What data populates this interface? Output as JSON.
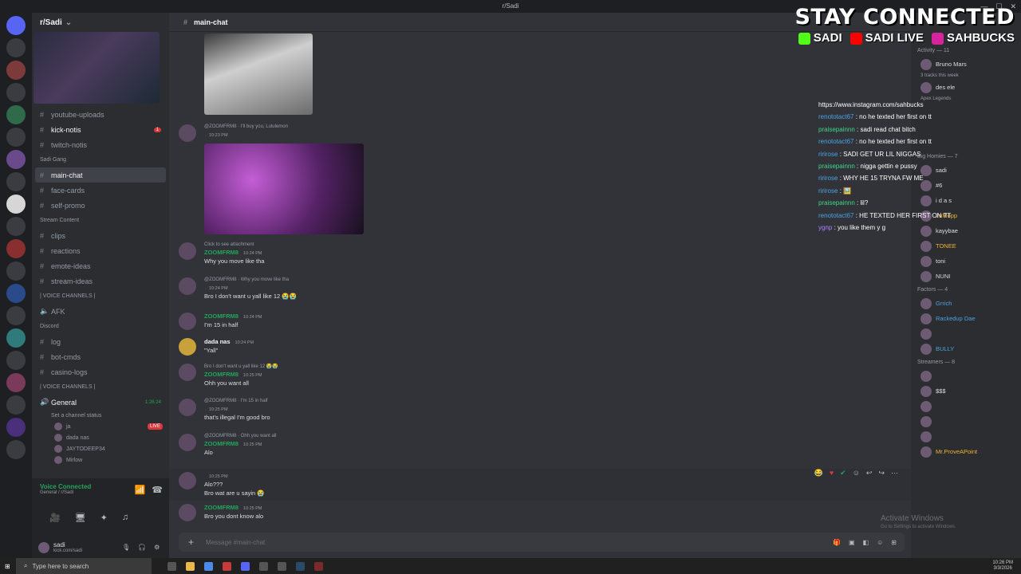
{
  "window": {
    "title": "r/Sadi"
  },
  "server": {
    "name": "r/Sadi",
    "channels_top": [
      {
        "label": "youtube-uploads"
      },
      {
        "label": "kick-notis",
        "badge": "1"
      },
      {
        "label": "twitch-notis"
      }
    ],
    "categories": {
      "sadi_gang": "Sadi Gang",
      "stream_content": "Stream Content",
      "voice": "| VOICE CHANNELS |",
      "discord": "Discord",
      "voice2": "| VOICE CHANNELS |"
    },
    "sadi_gang_channels": [
      {
        "label": "main-chat",
        "active": true
      },
      {
        "label": "face-cards"
      },
      {
        "label": "self-promo"
      }
    ],
    "stream_channels": [
      {
        "label": "clips"
      },
      {
        "label": "reactions"
      },
      {
        "label": "emote-ideas"
      },
      {
        "label": "stream-ideas"
      }
    ],
    "afk": "AFK",
    "discord_channels": [
      {
        "label": "log"
      },
      {
        "label": "bot-cmds"
      },
      {
        "label": "casino-logs"
      }
    ],
    "voice_general": {
      "label": "General",
      "timer": "1:26:24",
      "status": "Set a channel status"
    },
    "voice_users": [
      {
        "name": "ja",
        "live": "LIVE"
      },
      {
        "name": "dada nas"
      },
      {
        "name": "JAYTODEEP34"
      },
      {
        "name": "Mirlow"
      }
    ]
  },
  "voice_bar": {
    "title": "Voice Connected",
    "sub": "General / r/Sadi"
  },
  "user": {
    "name": "sadi",
    "status": "kick.com/sadi"
  },
  "chat": {
    "channel": "main-chat",
    "composer_placeholder": "Message #main-chat",
    "messages": [
      {
        "reply": "@ZOOMFRM8 · I'll buy you, Lululemon",
        "author": "",
        "time": "10:23 PM",
        "text": ""
      },
      {
        "reply": "Click to see attachment",
        "author": "ZOOMFRM8",
        "time": "10:24 PM",
        "text": "Why you move like tha"
      },
      {
        "reply": "@ZOOMFRM8 · Why you move like tha",
        "author": "",
        "time": "10:24 PM",
        "text": "Bro I don't want u yall like 12 😭😭"
      },
      {
        "reply": "",
        "author": "ZOOMFRM8",
        "time": "10:24 PM",
        "text": "I'm 15 in half"
      },
      {
        "reply": "",
        "author": "dada nas",
        "time": "10:24 PM",
        "text": "\"Yall\""
      },
      {
        "reply": "Bro I don't want u yall like 12 😭😭",
        "author": "ZOOMFRM8",
        "time": "10:25 PM",
        "text": "Ohh you want all"
      },
      {
        "reply": "@ZOOMFRM8 · I'm 15 in half",
        "author": "",
        "time": "10:25 PM",
        "text": "that's illegal I'm good bro"
      },
      {
        "reply": "@ZOOMFRM8 · Ohh you want all",
        "author": "ZOOMFRM8",
        "time": "10:25 PM",
        "text": "Alo"
      },
      {
        "reply": "",
        "author": "",
        "time": "10:25 PM",
        "text": "Alo???",
        "text2": "Bro wat are u sayin 😭"
      },
      {
        "reply": "",
        "author": "ZOOMFRM8",
        "time": "10:25 PM",
        "text": "Bro you dont know alo"
      }
    ]
  },
  "stream_chat": {
    "link": "https://www.instagram.com/sahbucks",
    "lines": [
      {
        "user": "renototact67",
        "color": "blue",
        "text": ": no he texted her first on tt"
      },
      {
        "user": "praisepainnn",
        "color": "green",
        "text": ": sadi read chat bitch"
      },
      {
        "user": "renototact67",
        "color": "blue",
        "text": ": no he texted her first on tt"
      },
      {
        "user": "ririrose",
        "color": "blue",
        "text": ": SADI GET UR LIL NIGGAS"
      },
      {
        "user": "praisepainnn",
        "color": "green",
        "text": ": nigga gettin e pussy"
      },
      {
        "user": "ririrose",
        "color": "blue",
        "text": ": WHY HE 15 TRYNA FW ME"
      },
      {
        "user": "ririrose",
        "color": "blue",
        "text": ": 🖼️"
      },
      {
        "user": "praisepainnn",
        "color": "green",
        "text": ": lil?"
      },
      {
        "user": "renototact67",
        "color": "blue",
        "text": ": HE TEXTED HER FIRST ON TT"
      },
      {
        "user": "ygnp",
        "color": "purple",
        "text": ": you like them y g"
      }
    ]
  },
  "overlay": {
    "title": "STAY CONNECTED",
    "kick": "SADI",
    "youtube": "SADI LIVE",
    "instagram": "SAHBUCKS",
    "colors": {
      "kick": "#53fc18",
      "youtube": "#ff0000",
      "instagram": "#d6249f"
    }
  },
  "members": {
    "activity_header": "Activity — 11",
    "activity": [
      {
        "name": "Bruno Mars",
        "sub": "3 tracks this week"
      },
      {
        "name": "des ele",
        "sub": "Apex Legends"
      }
    ],
    "big_homies": "Big Homies — 7",
    "big_homies_list": [
      "sadi",
      "#6",
      "i d a s",
      "ImMopp",
      "kayybae",
      "TONEE",
      "toni",
      "NUNI"
    ],
    "factors": "Factors — 4",
    "factors_list": [
      "Grrich",
      "Rackedup Dae",
      "",
      "BULLY"
    ],
    "streamers": "Streamers — 8",
    "streamers_list": [
      "",
      "$$$",
      "",
      "",
      "",
      "Mr.ProveAPoint",
      "",
      ""
    ]
  },
  "watermark": {
    "line1": "Activate Windows",
    "line2": "Go to Settings to activate Windows."
  },
  "taskbar": {
    "search": "Type here to search",
    "time": "10:26 PM",
    "date": "3/3/2026"
  }
}
